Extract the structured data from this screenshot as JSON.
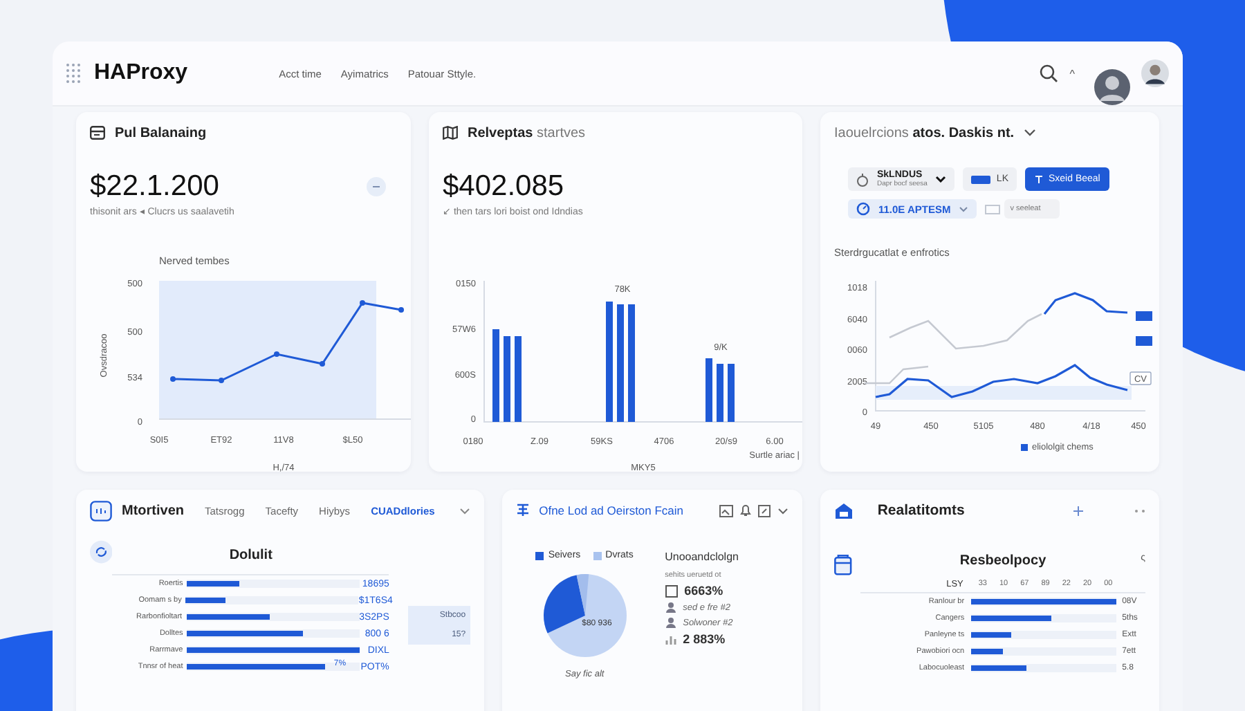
{
  "header": {
    "brand": "HAProxy",
    "nav": [
      "Acct time",
      "Ayimatrics",
      "Patouar Sttyle."
    ],
    "caret": "^"
  },
  "pool_card": {
    "title": "Pul Balanaing",
    "value": "$22.1.200",
    "subtitle": "thisonit ars ◂ Clucrs us saalavetih",
    "chart_title": "Nerved tembes",
    "ylabel": "Ovsdracoo",
    "yticks": [
      "500",
      "500",
      "534",
      "0"
    ],
    "xticks": [
      "S0I5",
      "ET92",
      "11V8",
      "$L50"
    ],
    "xlabel": "H,/74"
  },
  "revenue_card": {
    "title_bold": "Relveptas",
    "title_light": "startves",
    "value": "$402.085",
    "subtitle": "↙ then tars lori boist ond Idndias",
    "yticks": [
      "0150",
      "57W6",
      "600S",
      "0"
    ],
    "bar_labels": [
      "78K",
      "9/K"
    ],
    "xticks": [
      "0180",
      "Z.09",
      "59KS",
      "4706",
      "20/s9",
      "6.00"
    ],
    "xlabel": "MKY5",
    "note": "Surtle ariac |"
  },
  "sessions_card": {
    "title_light": "Iaouelrcions",
    "title_bold": "atos. Daskis nt.",
    "dropdown": {
      "value": "SkLNDUS",
      "hint": "Dapr bocf seesa"
    },
    "chip": "LK",
    "button": "Sxeid Beeal",
    "filter": "11.0E APTESM",
    "disabled_field": {
      "placeholder": "v seeleat"
    },
    "chart_title": "Sterdrgucatlat e enfrotics",
    "yticks": [
      "1018",
      "6040",
      "0060",
      "2005",
      "0"
    ],
    "xticks": [
      "49",
      "450",
      "5105",
      "480",
      "4/18",
      "450"
    ],
    "tag": "CV",
    "legend": "eliololgit chems"
  },
  "monitor_card": {
    "title": "Mtortiven",
    "tabs": [
      {
        "label": "Tatsrogg",
        "selected": false
      },
      {
        "label": "Tacefty",
        "selected": false
      },
      {
        "label": "Hiybys",
        "selected": false
      },
      {
        "label": "CUADdlories",
        "selected": true
      }
    ],
    "heading": "Dolulit",
    "rows": [
      {
        "label": "Roertis",
        "level": 0.3,
        "value": "18695"
      },
      {
        "label": "Oomam s by",
        "level": 0.23,
        "value": "$1T6S4"
      },
      {
        "label": "Rarbonfioltart",
        "level": 0.48,
        "value": "3S2PS"
      },
      {
        "label": "Dolltes",
        "level": 0.67,
        "value": "800 6"
      },
      {
        "label": "Rarrmave",
        "level": 1.0,
        "value": "DIXL"
      },
      {
        "label": "Tnnsr of heat",
        "level": 0.8,
        "value": "POT%",
        "bar_text": "7%"
      }
    ],
    "mini": [
      "Stbcoo",
      "15?"
    ]
  },
  "origin_card": {
    "title": "Ofne Lod ad Oeirston Fcain",
    "legend": [
      "Seivers",
      "Dvrats"
    ],
    "pie_label": "$80 936",
    "caption": "Say fic alt",
    "heading": "Unooandclolgn",
    "subheading": "sehits ueruetd ot",
    "items": [
      {
        "kind": "checkbox",
        "text": "6663%",
        "checked": false
      },
      {
        "kind": "icon",
        "text": "sed e fre #2"
      },
      {
        "kind": "icon",
        "text": "Solwoner #2"
      },
      {
        "kind": "stat",
        "text": "2 883%"
      }
    ]
  },
  "relations_card": {
    "title": "Realatitomts",
    "heading": "Resbeolpocy",
    "corner": "ς",
    "axis": [
      "LSY",
      "33",
      "10",
      "67",
      "89",
      "22",
      "20",
      "00"
    ],
    "rows": [
      {
        "label": "Ranlour br",
        "level": 1.0,
        "value": "08V"
      },
      {
        "label": "Cangers",
        "level": 0.55,
        "value": "5ths"
      },
      {
        "label": "Panleyne ts",
        "level": 0.28,
        "value": "Extt"
      },
      {
        "label": "Pawobiori ocn",
        "level": 0.22,
        "value": "7ett"
      },
      {
        "label": "Labocuoleast",
        "level": 0.38,
        "value": "5.8"
      }
    ]
  }
}
